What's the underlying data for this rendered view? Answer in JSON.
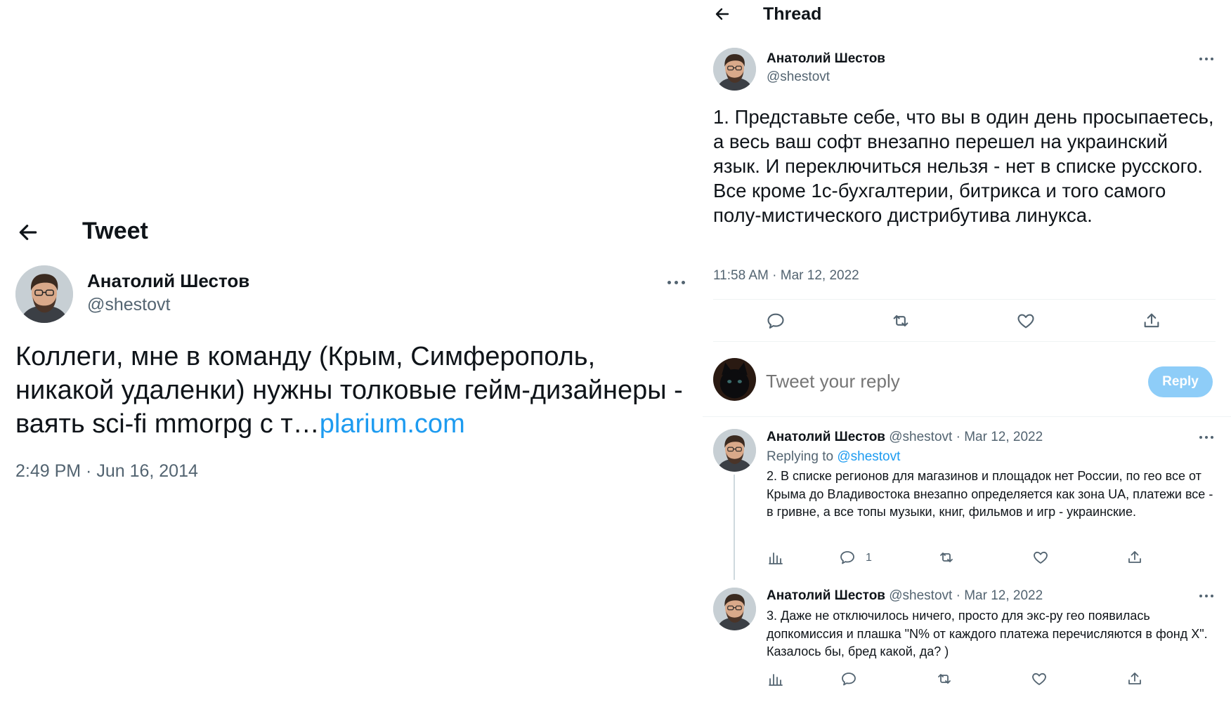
{
  "left": {
    "header_title": "Tweet",
    "author": {
      "name": "Анатолий Шестов",
      "handle": "@shestovt"
    },
    "body_text": "Коллеги, мне в команду (Крым, Симферополь, никакой удаленки) нужны толковые гейм-дизайнеры - ваять sci-fi mmorpg с т…",
    "body_link": "plarium.com",
    "timestamp": "2:49 PM · Jun 16, 2014"
  },
  "right": {
    "header_title": "Thread",
    "main": {
      "author_name": "Анатолий Шестов",
      "author_handle": "@shestovt",
      "text": "1. Представьте себе, что вы в один день просыпаетесь, а весь ваш софт внезапно перешел на украинский язык. И переключиться нельзя - нет в списке русского. Все кроме 1с-бухгалтерии, битрикса и того самого полу-мистического дистрибутива линукса.",
      "timestamp": "11:58 AM · Mar 12, 2022"
    },
    "compose": {
      "placeholder": "Tweet your reply",
      "button_label": "Reply"
    },
    "replies": [
      {
        "author_name": "Анатолий Шестов",
        "meta": "@shestovt · Mar 12, 2022",
        "replying_prefix": "Replying to",
        "replying_handle": "@shestovt",
        "text": "2. В списке регионов для магазинов и площадок нет России, по гео все от Крыма до Владивостока внезапно определяется как зона UA, платежи все - в гривне, а все топы музыки, книг, фильмов и игр - украинские.",
        "reply_count": "1"
      },
      {
        "author_name": "Анатолий Шестов",
        "meta": "@shestovt · Mar 12, 2022",
        "text": "3. Даже не отключилось ничего, просто для экс-ру гео появилась допкомиссия и плашка \"N% от каждого платежа перечисляются в фонд X\". Казалось бы, бред какой, да? )"
      }
    ]
  },
  "colors": {
    "link": "#1d9bf0",
    "muted": "#536471",
    "reply_button": "#8ecdf8"
  },
  "icons": [
    "back-arrow-icon",
    "more-icon",
    "reply-icon",
    "retweet-icon",
    "like-icon",
    "share-icon",
    "analytics-icon"
  ]
}
